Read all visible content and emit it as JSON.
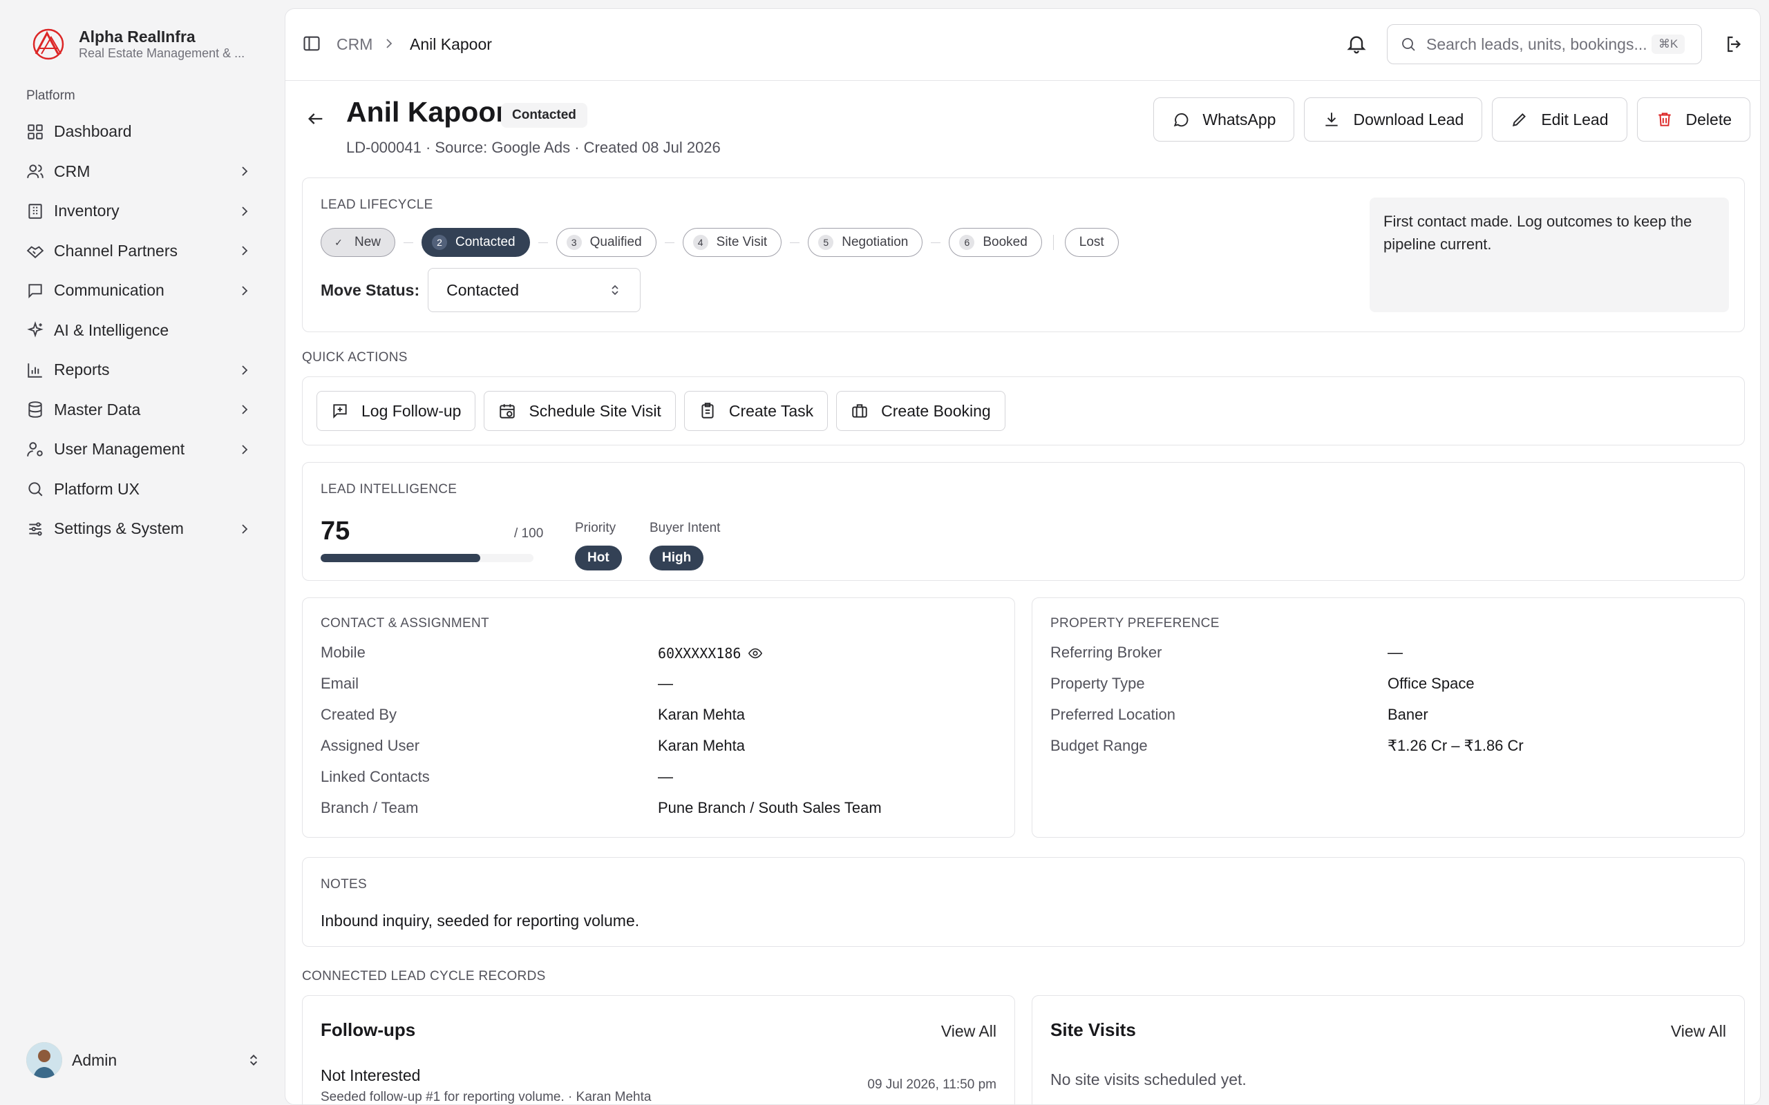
{
  "brand": {
    "name": "Alpha RealInfra",
    "subtitle": "Real Estate Management & ..."
  },
  "sidebar": {
    "group_label": "Platform",
    "items": [
      {
        "label": "Dashboard",
        "icon": "grid-icon",
        "chevron": false
      },
      {
        "label": "CRM",
        "icon": "users-icon",
        "chevron": true
      },
      {
        "label": "Inventory",
        "icon": "building-icon",
        "chevron": true
      },
      {
        "label": "Channel Partners",
        "icon": "handshake-icon",
        "chevron": true
      },
      {
        "label": "Communication",
        "icon": "message-icon",
        "chevron": true
      },
      {
        "label": "AI & Intelligence",
        "icon": "sparkles-icon",
        "chevron": false
      },
      {
        "label": "Reports",
        "icon": "bar-chart-icon",
        "chevron": true
      },
      {
        "label": "Master Data",
        "icon": "database-icon",
        "chevron": true
      },
      {
        "label": "User Management",
        "icon": "user-cog-icon",
        "chevron": true
      },
      {
        "label": "Platform UX",
        "icon": "search-icon",
        "chevron": false
      },
      {
        "label": "Settings & System",
        "icon": "sliders-icon",
        "chevron": true
      }
    ],
    "user": {
      "name": "Admin"
    }
  },
  "topbar": {
    "breadcrumb": [
      "CRM",
      "Anil Kapoor"
    ],
    "search_placeholder": "Search leads, units, bookings...",
    "shortcut": "⌘K"
  },
  "lead": {
    "name": "Anil Kapoor",
    "status": "Contacted",
    "meta": "LD-000041 · Source: Google Ads · Created 08 Jul 2026",
    "actions": [
      "WhatsApp",
      "Download Lead",
      "Edit Lead",
      "Delete"
    ]
  },
  "lifecycle": {
    "label": "LEAD LIFECYCLE",
    "steps": [
      {
        "num": "✓",
        "label": "New",
        "state": "done"
      },
      {
        "num": "2",
        "label": "Contacted",
        "state": "active"
      },
      {
        "num": "3",
        "label": "Qualified",
        "state": "todo"
      },
      {
        "num": "4",
        "label": "Site Visit",
        "state": "todo"
      },
      {
        "num": "5",
        "label": "Negotiation",
        "state": "todo"
      },
      {
        "num": "6",
        "label": "Booked",
        "state": "todo"
      }
    ],
    "lost_label": "Lost",
    "move_label": "Move Status:",
    "move_value": "Contacted",
    "hint": "First contact made. Log outcomes to keep the pipeline current."
  },
  "quick_actions": {
    "label": "QUICK ACTIONS",
    "buttons": [
      "Log Follow-up",
      "Schedule Site Visit",
      "Create Task",
      "Create Booking"
    ]
  },
  "intelligence": {
    "label": "LEAD INTELLIGENCE",
    "score": "75",
    "score_max": "/ 100",
    "score_fraction": 0.75,
    "priority_label": "Priority",
    "priority": "Hot",
    "intent_label": "Buyer Intent",
    "intent": "High"
  },
  "contact": {
    "label": "CONTACT & ASSIGNMENT",
    "rows": [
      {
        "k": "Mobile",
        "v": "60XXXXX186"
      },
      {
        "k": "Email",
        "v": "—"
      },
      {
        "k": "Created By",
        "v": "Karan Mehta"
      },
      {
        "k": "Assigned User",
        "v": "Karan Mehta"
      },
      {
        "k": "Linked Contacts",
        "v": "—"
      },
      {
        "k": "Branch / Team",
        "v": "Pune Branch / South Sales Team"
      }
    ]
  },
  "property": {
    "label": "PROPERTY PREFERENCE",
    "rows": [
      {
        "k": "Referring Broker",
        "v": "—"
      },
      {
        "k": "Property Type",
        "v": "Office Space"
      },
      {
        "k": "Preferred Location",
        "v": "Baner"
      },
      {
        "k": "Budget Range",
        "v": "₹1.26 Cr – ₹1.86 Cr"
      }
    ]
  },
  "notes": {
    "label": "NOTES",
    "text": "Inbound inquiry, seeded for reporting volume."
  },
  "records": {
    "label": "CONNECTED LEAD CYCLE RECORDS",
    "followups": {
      "title": "Follow-ups",
      "view_all": "View All",
      "item_title": "Not Interested",
      "item_sub": "Seeded follow-up #1 for reporting volume. · Karan Mehta",
      "item_date": "09 Jul 2026, 11:50 pm"
    },
    "site_visits": {
      "title": "Site Visits",
      "view_all": "View All",
      "empty": "No site visits scheduled yet."
    }
  },
  "colors": {
    "accent": "#334155",
    "brand_red": "#dc2626",
    "border": "#e4e4e7"
  }
}
